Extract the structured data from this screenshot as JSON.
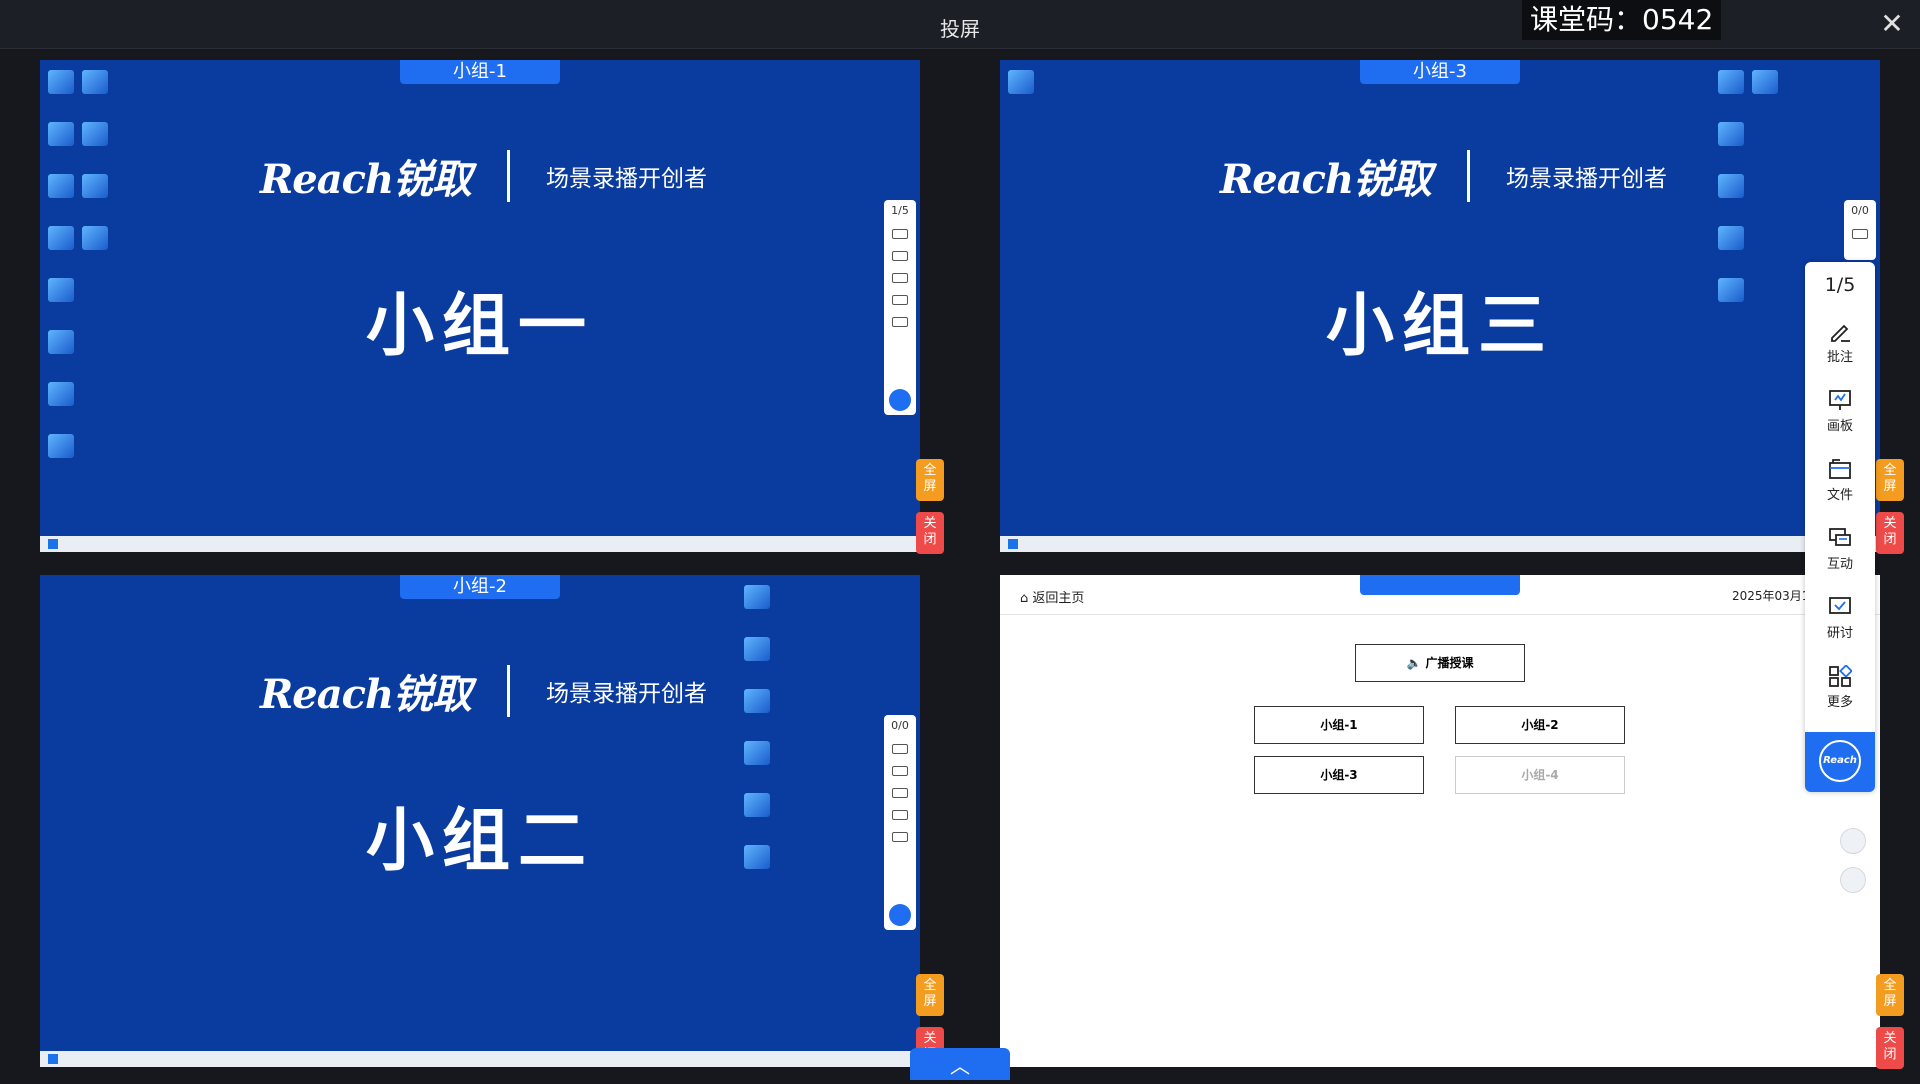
{
  "header": {
    "title": "投屏",
    "class_code": "课堂码：0542",
    "close_label": "✕"
  },
  "panes": {
    "p1": {
      "tag": "小组-1",
      "logo": "Reach锐取",
      "slogan": "场景录播开创者",
      "big_title": "小组一",
      "page_count": "1/5"
    },
    "p2": {
      "tag": "小组-2",
      "logo": "Reach锐取",
      "slogan": "场景录播开创者",
      "big_title": "小组二",
      "page_count": "0/0"
    },
    "p3": {
      "tag": "小组-3",
      "logo": "Reach锐取",
      "slogan": "场景录播开创者",
      "big_title": "小组三",
      "page_count": "0/0"
    },
    "p4": {
      "home": "⌂ 返回主页",
      "date": "2025年03月1(",
      "broadcast": "🔈 广播授课",
      "groups": [
        "小组-1",
        "小组-2",
        "小组-3",
        "小组-4"
      ]
    }
  },
  "side": {
    "full": "全\n屏",
    "off": "关\n闭"
  },
  "toolbar": {
    "count": "1/5",
    "tools": [
      "批注",
      "画板",
      "文件",
      "互动",
      "研讨",
      "更多"
    ],
    "brand": "Reach"
  },
  "collapse_icon": "︿"
}
